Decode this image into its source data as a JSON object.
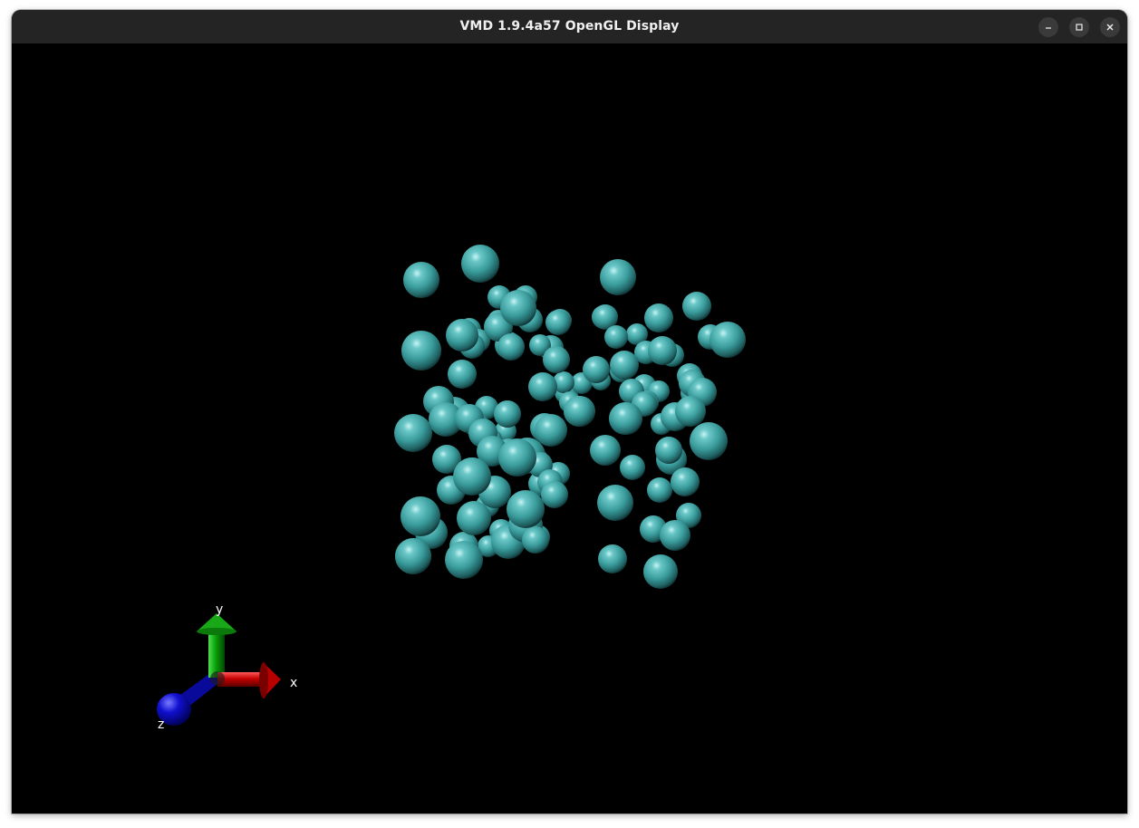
{
  "window": {
    "title": "VMD 1.9.4a57 OpenGL Display",
    "controls": {
      "minimize": "minimize-icon",
      "maximize": "maximize-icon",
      "close": "close-icon"
    }
  },
  "scene": {
    "background": "#000000",
    "atom_color": "#3fa5a5",
    "axes": {
      "x_label": "x",
      "y_label": "y",
      "z_label": "z",
      "x_color": "#cc0000",
      "y_color": "#00aa00",
      "z_color": "#0000cc"
    }
  }
}
